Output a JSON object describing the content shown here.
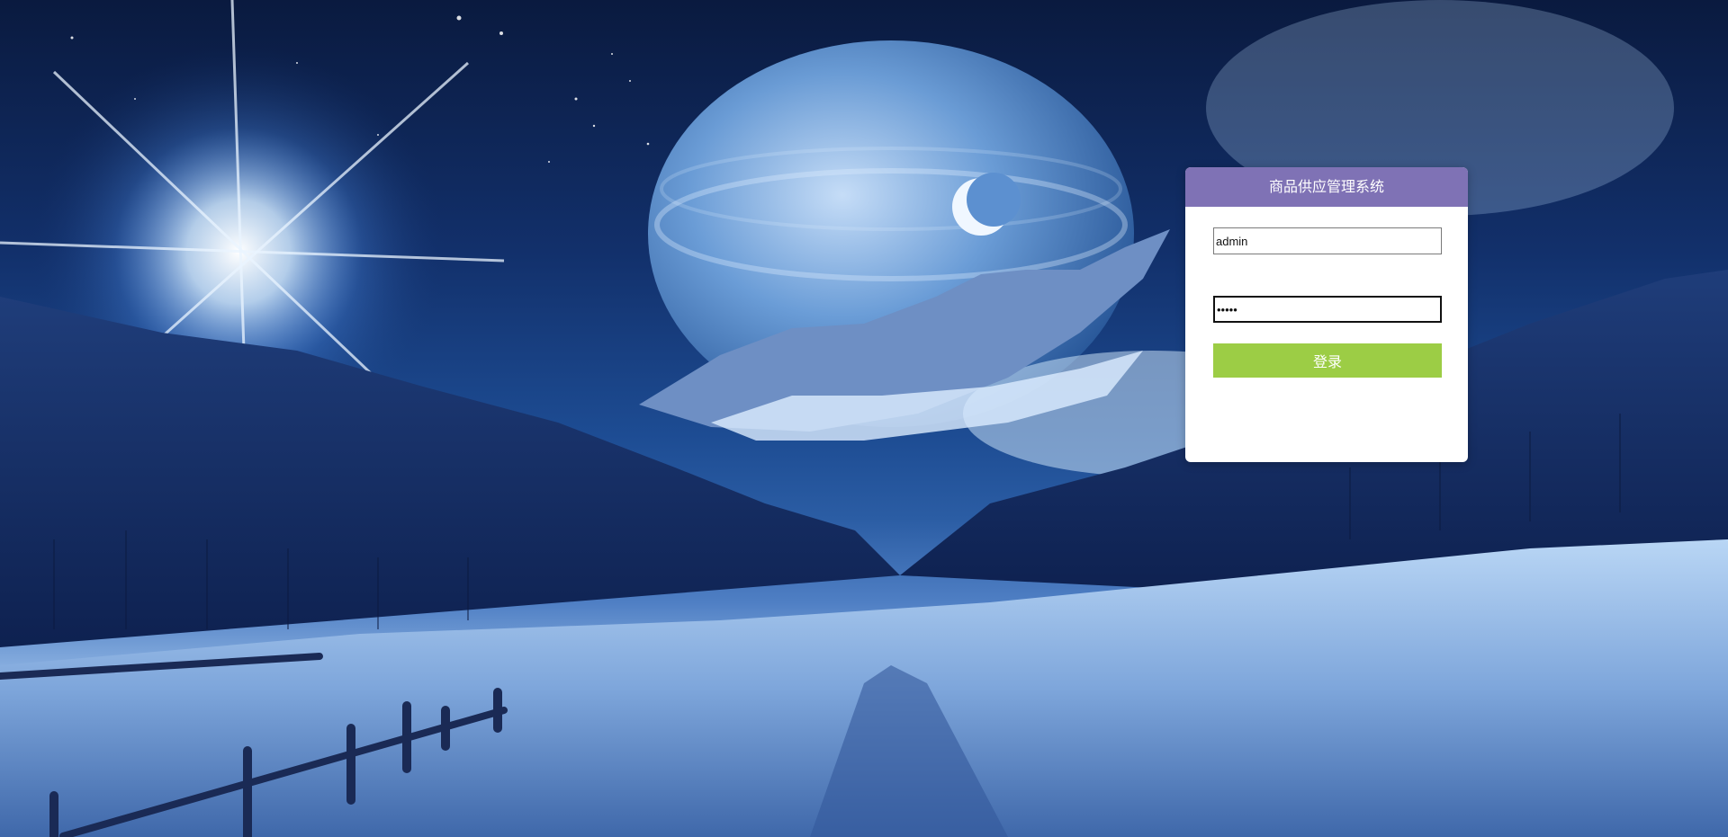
{
  "login": {
    "title": "商品供应管理系统",
    "username_value": "admin",
    "password_value": "•••••",
    "submit_label": "登录"
  },
  "colors": {
    "header": "#7f72b5",
    "button": "#9ccd45",
    "panel": "#ffffff"
  }
}
